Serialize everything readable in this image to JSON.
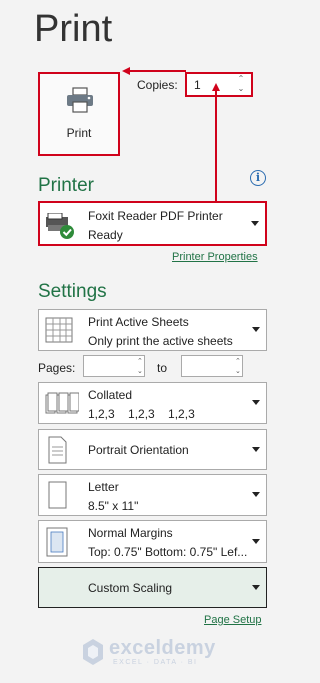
{
  "page": {
    "title": "Print"
  },
  "print_button": {
    "label": "Print"
  },
  "copies": {
    "label": "Copies:",
    "value": "1"
  },
  "printer": {
    "section_title": "Printer",
    "name": "Foxit Reader PDF Printer",
    "status": "Ready",
    "properties_link": "Printer Properties"
  },
  "settings": {
    "section_title": "Settings",
    "print_what": {
      "line1": "Print Active Sheets",
      "line2": "Only print the active sheets"
    },
    "pages": {
      "label": "Pages:",
      "to_label": "to",
      "from_value": "",
      "to_value": ""
    },
    "collation": {
      "line1": "Collated",
      "line2": "1,2,3    1,2,3    1,2,3"
    },
    "orientation": {
      "label": "Portrait Orientation"
    },
    "paper": {
      "line1": "Letter",
      "line2": "8.5\" x 11\""
    },
    "margins": {
      "line1": "Normal Margins",
      "line2": "Top: 0.75\" Bottom: 0.75\" Lef..."
    },
    "scaling": {
      "label": "Custom Scaling"
    },
    "page_setup_link": "Page Setup"
  },
  "watermark": {
    "brand": "exceldemy",
    "tagline": "EXCEL · DATA · BI"
  },
  "colors": {
    "accent": "#217346",
    "highlight": "#d0021b"
  }
}
